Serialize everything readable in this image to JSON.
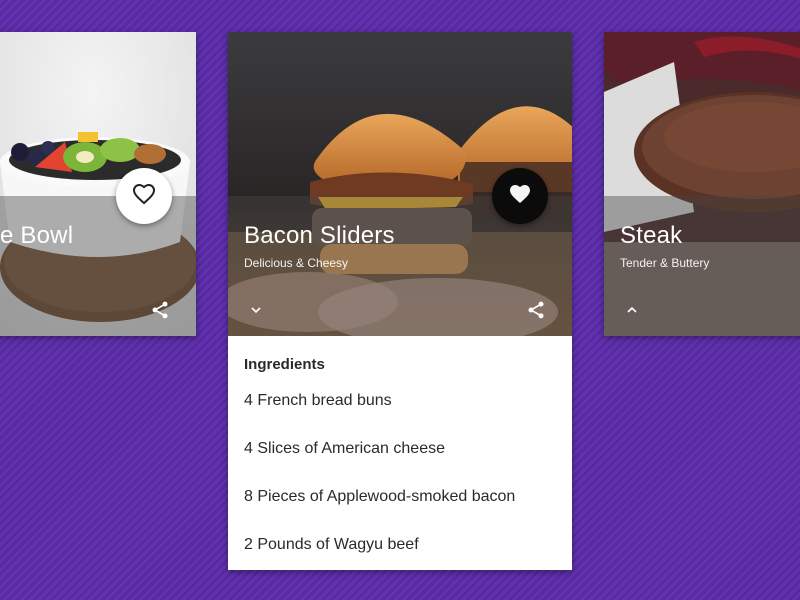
{
  "cards": {
    "left": {
      "title": "Acai Berry Bowl",
      "visible_title": "e Bowl"
    },
    "center": {
      "title": "Bacon Sliders",
      "subtitle": "Delicious & Cheesy",
      "ingredients_heading": "Ingredients",
      "ingredients": [
        "4 French bread buns",
        "4 Slices of American cheese",
        "8 Pieces of Applewood-smoked bacon",
        "2 Pounds of Wagyu beef"
      ]
    },
    "right": {
      "title": "Steak",
      "subtitle": "Tender & Buttery"
    }
  },
  "icons": {
    "favorite_outline": "heart-outline-icon",
    "favorite_filled": "heart-filled-icon",
    "share": "share-icon",
    "expand": "chevron-down-icon",
    "collapse": "chevron-up-icon"
  },
  "colors": {
    "background": "#5a2aa8",
    "card": "#ffffff",
    "fab_white": "#ffffff",
    "fab_black": "#0b0b0b"
  }
}
